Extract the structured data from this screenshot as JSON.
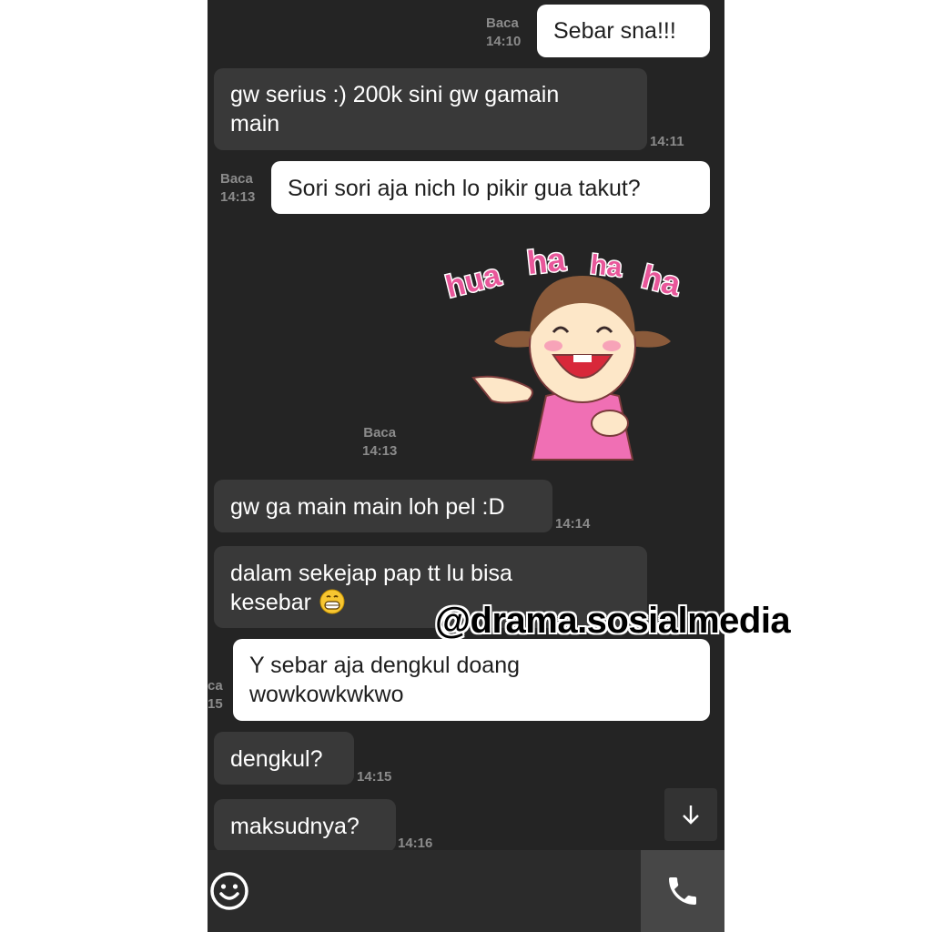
{
  "messages": [
    {
      "dir": "out",
      "text": "Sebar sna!!!",
      "status": "Baca",
      "time": "14:10"
    },
    {
      "dir": "in",
      "lines": [
        "gw serius :) 200k sini gw gamain",
        "main"
      ],
      "time": "14:11"
    },
    {
      "dir": "out",
      "text": "Sori sori aja nich lo pikir gua takut?",
      "status": "Baca",
      "time": "14:13"
    },
    {
      "dir": "out",
      "type": "sticker",
      "sticker_text": [
        "hua",
        "ha",
        "ha",
        "ha"
      ],
      "status": "Baca",
      "time": "14:13"
    },
    {
      "dir": "in",
      "text": "gw ga main main loh pel :D",
      "time": "14:14"
    },
    {
      "dir": "in",
      "lines": [
        "dalam sekejap pap tt lu bisa",
        "kesebar"
      ],
      "emoji": "grinning-face",
      "time": ""
    },
    {
      "dir": "out",
      "lines": [
        "Y sebar aja dengkul doang",
        "wowkowkwkwo"
      ],
      "status": "ca",
      "time": "15"
    },
    {
      "dir": "in",
      "text": "dengkul?",
      "time": "14:15"
    },
    {
      "dir": "in",
      "text": "maksudnya?",
      "time": "14:16"
    }
  ],
  "watermark": "@drama.sosialmedia",
  "icons": {
    "scroll_down": "arrow-down-icon",
    "emoji": "smiley-icon",
    "call": "phone-icon"
  },
  "colors": {
    "background": "#242424",
    "incoming_bubble": "#393939",
    "outgoing_bubble": "#ffffff",
    "meta_text": "#8b8b8b",
    "sticker_text": "#e8579a"
  }
}
